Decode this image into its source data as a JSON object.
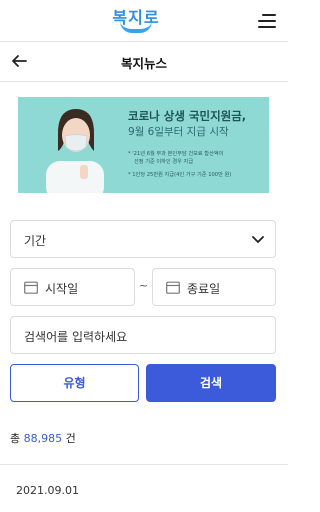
{
  "header": {
    "logo_text": "복지로",
    "menu_icon": "hamburger-icon"
  },
  "subheader": {
    "back_icon": "arrow-left-icon",
    "title": "복지뉴스"
  },
  "banner": {
    "title": "코로나 상생 국민지원금,",
    "subtitle": "9월 6일부터 지급 시작",
    "bullet1_line1": "* '21년 6월 부과 본인부담 건보료 합산액이",
    "bullet1_line2": "선정 기준 이하인 경우 지급",
    "bullet2": "* 1인당 25만원 지급(4인 가구 기준 100만 원)"
  },
  "filters": {
    "period_label": "기간",
    "period_icon": "chevron-down-icon",
    "start_date_label": "시작일",
    "end_date_label": "종료일",
    "date_icon": "calendar-icon",
    "range_separator": "~",
    "search_placeholder": "검색어를 입력하세요"
  },
  "buttons": {
    "type_label": "유형",
    "search_label": "검색"
  },
  "results": {
    "total_prefix": "총",
    "total_count": "88,985",
    "total_suffix": "건",
    "items": [
      {
        "date": "2021.09.01"
      }
    ]
  },
  "colors": {
    "accent": "#3b5bdb",
    "banner_bg": "#8fd9d5",
    "logo_blue": "#2c8fe3"
  }
}
